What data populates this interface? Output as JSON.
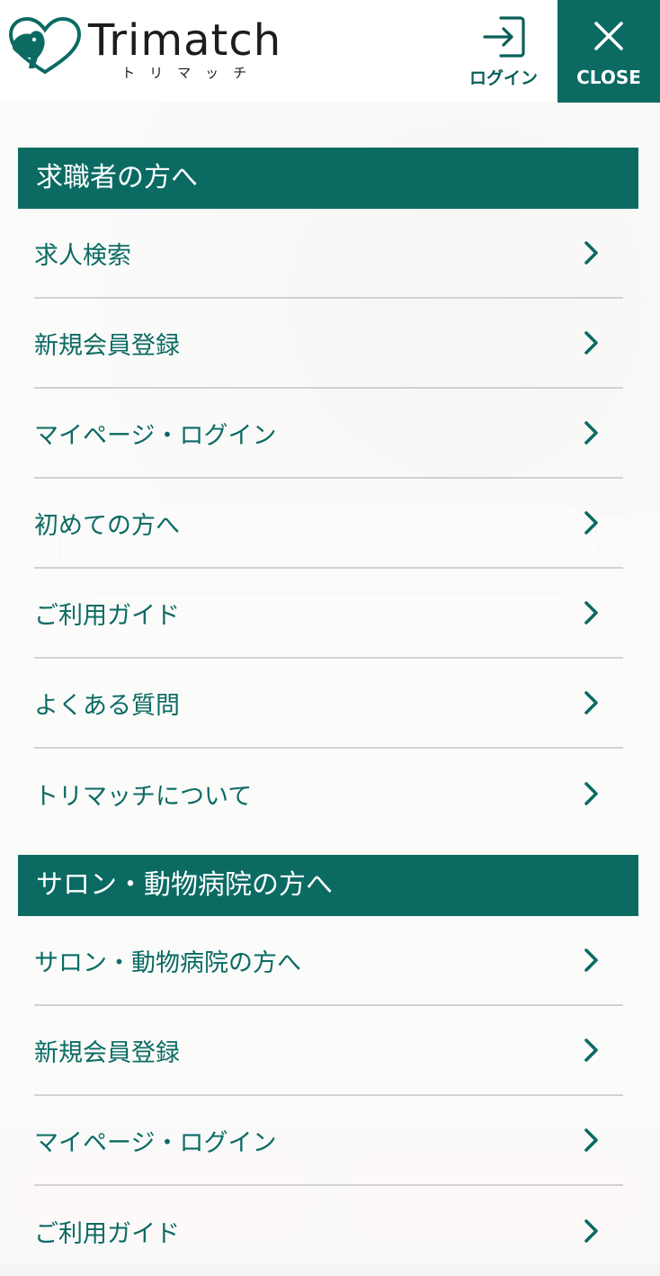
{
  "header": {
    "logo_text": "Trimatch",
    "logo_sub": "トリマッチ",
    "login_label": "ログイン",
    "close_label": "CLOSE"
  },
  "colors": {
    "brand": "#0b6b63",
    "divider": "#cfd3d2"
  },
  "menu": {
    "sections": [
      {
        "title": "求職者の方へ",
        "items": [
          {
            "label": "求人検索"
          },
          {
            "label": "新規会員登録"
          },
          {
            "label": "マイページ・ログイン"
          },
          {
            "label": "初めての方へ"
          },
          {
            "label": "ご利用ガイド"
          },
          {
            "label": "よくある質問"
          },
          {
            "label": "トリマッチについて"
          }
        ]
      },
      {
        "title": "サロン・動物病院の方へ",
        "items": [
          {
            "label": "サロン・動物病院の方へ"
          },
          {
            "label": "新規会員登録"
          },
          {
            "label": "マイページ・ログイン"
          },
          {
            "label": "ご利用ガイド"
          }
        ]
      }
    ]
  },
  "icons": {
    "login": "login-arrow-icon",
    "close": "close-icon",
    "chevron": "chevron-right-icon",
    "logo": "dog-heart-logo-icon"
  }
}
